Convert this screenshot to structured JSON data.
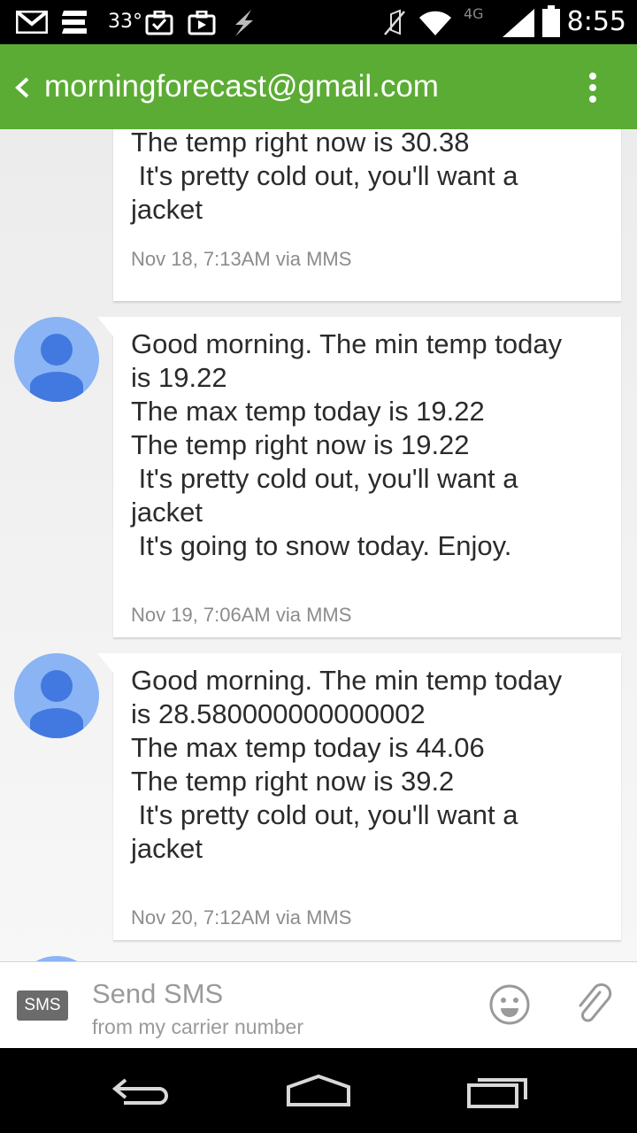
{
  "status_bar": {
    "temperature": "33°",
    "network": "4G LTE",
    "time": "8:55"
  },
  "action_bar": {
    "title": "morningforecast@gmail.com",
    "accent_color": "#5bac34"
  },
  "messages": [
    {
      "text": "The temp right now is 30.38\n It's pretty cold out, you'll want a\njacket",
      "meta": "Nov 18, 7:13AM via MMS"
    },
    {
      "text": "Good morning. The min temp today\nis 19.22\nThe max temp today is 19.22\nThe temp right now is 19.22\n It's pretty cold out, you'll want a\njacket\n It's going to snow today. Enjoy.",
      "meta": "Nov 19, 7:06AM via MMS"
    },
    {
      "text": "Good morning. The min temp today\nis 28.580000000000002\nThe max temp today is 44.06\nThe temp right now is 39.2\n It's pretty cold out, you'll want a\njacket",
      "meta": "Nov 20, 7:12AM via MMS"
    }
  ],
  "compose": {
    "badge": "SMS",
    "placeholder": "Send SMS",
    "subtitle": "from my carrier number"
  },
  "icons": {
    "status": [
      "gmail-icon",
      "notes-icon",
      "briefcase-icon",
      "briefcase-icon",
      "flash-icon",
      "mute-icon",
      "wifi-icon",
      "signal-icon",
      "battery-icon"
    ],
    "compose": [
      "emoji-icon",
      "attach-icon"
    ],
    "nav": [
      "back-nav-icon",
      "home-nav-icon",
      "recents-nav-icon"
    ]
  }
}
